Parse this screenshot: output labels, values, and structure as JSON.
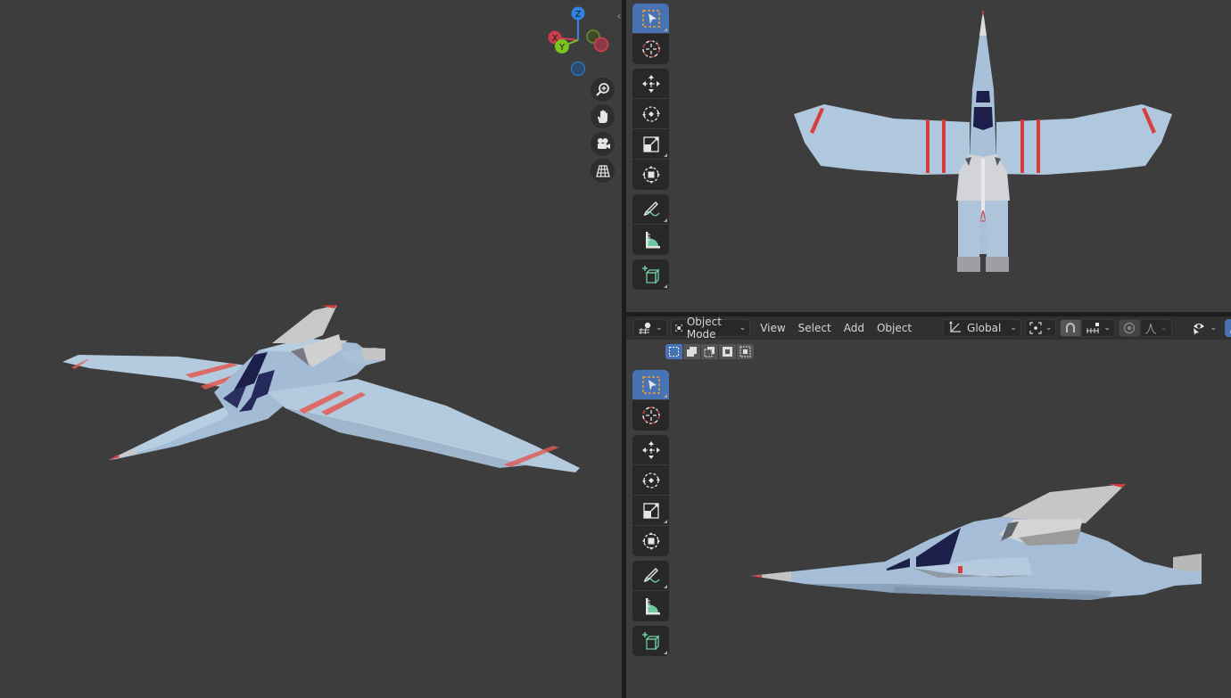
{
  "app": "Blender",
  "viewports": {
    "perspective": {
      "gizmo": {
        "axes": [
          {
            "label": "Z",
            "color": "#2f83e3"
          },
          {
            "label": "X",
            "color": "#d63e50"
          },
          {
            "label": "Y",
            "color": "#7cc31f"
          }
        ]
      },
      "nav_buttons": [
        {
          "icon": "zoom-in-icon",
          "tooltip": "Zoom"
        },
        {
          "icon": "hand-icon",
          "tooltip": "Pan"
        },
        {
          "icon": "camera-icon",
          "tooltip": "Camera View"
        },
        {
          "icon": "grid-icon",
          "tooltip": "Orthographic/Perspective"
        }
      ],
      "collapse_glyph": "‹"
    },
    "side": {
      "header": {
        "editor_type_icon": "view3d-icon",
        "mode": "Object Mode",
        "menus": [
          "View",
          "Select",
          "Add",
          "Object"
        ],
        "transform_orientation": "Global"
      }
    }
  },
  "toolbar": [
    {
      "group": 1,
      "tools": [
        {
          "name": "select-box",
          "icon": "select-box-icon",
          "active": true
        },
        {
          "name": "cursor",
          "icon": "cursor-icon",
          "active": false
        }
      ]
    },
    {
      "group": 2,
      "tools": [
        {
          "name": "move",
          "icon": "move-icon"
        },
        {
          "name": "rotate",
          "icon": "rotate-icon"
        },
        {
          "name": "scale",
          "icon": "scale-icon"
        },
        {
          "name": "transform",
          "icon": "transform-icon"
        }
      ]
    },
    {
      "group": 3,
      "tools": [
        {
          "name": "annotate",
          "icon": "annotate-icon"
        },
        {
          "name": "measure",
          "icon": "measure-icon"
        }
      ]
    },
    {
      "group": 4,
      "tools": [
        {
          "name": "add-cube",
          "icon": "add-cube-icon"
        }
      ]
    }
  ],
  "colors": {
    "accent": "#4772b3",
    "viewport_bg": "#3d3d3d",
    "hull": "#a9c3db",
    "stripe": "#d9453d",
    "cockpit": "#1b1f4a"
  }
}
